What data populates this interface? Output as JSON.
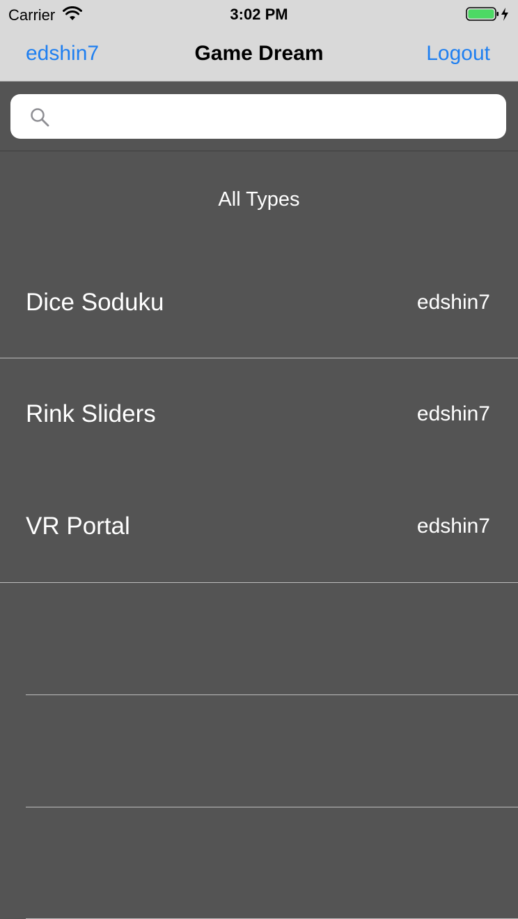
{
  "status_bar": {
    "carrier": "Carrier",
    "time": "3:02 PM",
    "icons": [
      "wifi-icon",
      "battery-icon",
      "charging-bolt-icon"
    ],
    "battery_color": "#4cd964"
  },
  "nav": {
    "left_label": "edshin7",
    "title": "Game Dream",
    "right_label": "Logout",
    "accent_color": "#1f7ff0"
  },
  "search": {
    "value": "",
    "placeholder": "",
    "icon": "search-icon"
  },
  "list": {
    "section_title": "All Types",
    "rows": [
      {
        "name": "Dice Soduku",
        "owner": "edshin7"
      },
      {
        "name": "Rink Sliders",
        "owner": "edshin7"
      },
      {
        "name": "VR Portal",
        "owner": "edshin7"
      }
    ]
  }
}
